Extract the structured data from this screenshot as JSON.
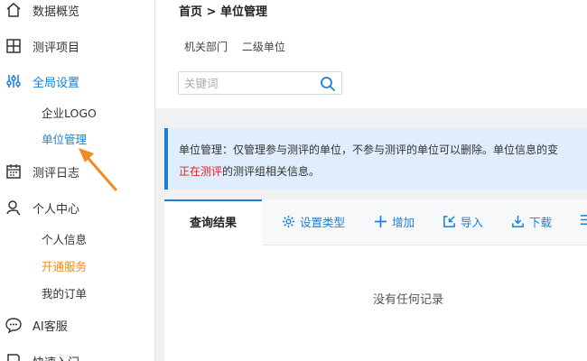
{
  "sidebar": {
    "items": [
      {
        "label": "数据概览",
        "icon": "home-icon"
      },
      {
        "label": "测评项目",
        "icon": "grid-icon"
      },
      {
        "label": "全局设置",
        "icon": "sliders-icon"
      },
      {
        "label": "测评日志",
        "icon": "calendar-icon"
      },
      {
        "label": "个人中心",
        "icon": "user-icon"
      },
      {
        "label": "AI客服",
        "icon": "chat-icon"
      },
      {
        "label": "快速入门",
        "icon": "book-icon"
      }
    ],
    "global_sub": [
      "企业LOGO",
      "单位管理"
    ],
    "personal_sub": [
      "个人信息",
      "开通服务",
      "我的订单"
    ]
  },
  "header": {
    "breadcrumb": "首页 > 单位管理",
    "tree_path": [
      "机关部门",
      "二级单位"
    ]
  },
  "search": {
    "placeholder": "关键词"
  },
  "notice": {
    "line1": "单位管理：仅管理参与测评的单位，不参与测评的单位可以删除。单位信息的变",
    "line2_red": "正在测评",
    "line2_rest": "的测评组相关信息。"
  },
  "panel": {
    "tab_label": "查询结果",
    "toolbar": {
      "set_type": "设置类型",
      "add": "增加",
      "import": "导入",
      "download": "下载"
    },
    "empty": "没有任何记录"
  },
  "colors": {
    "accent": "#1a7fd8",
    "highlight": "#f08a24",
    "danger": "#e02020",
    "notice_bg": "#dfedfc"
  }
}
